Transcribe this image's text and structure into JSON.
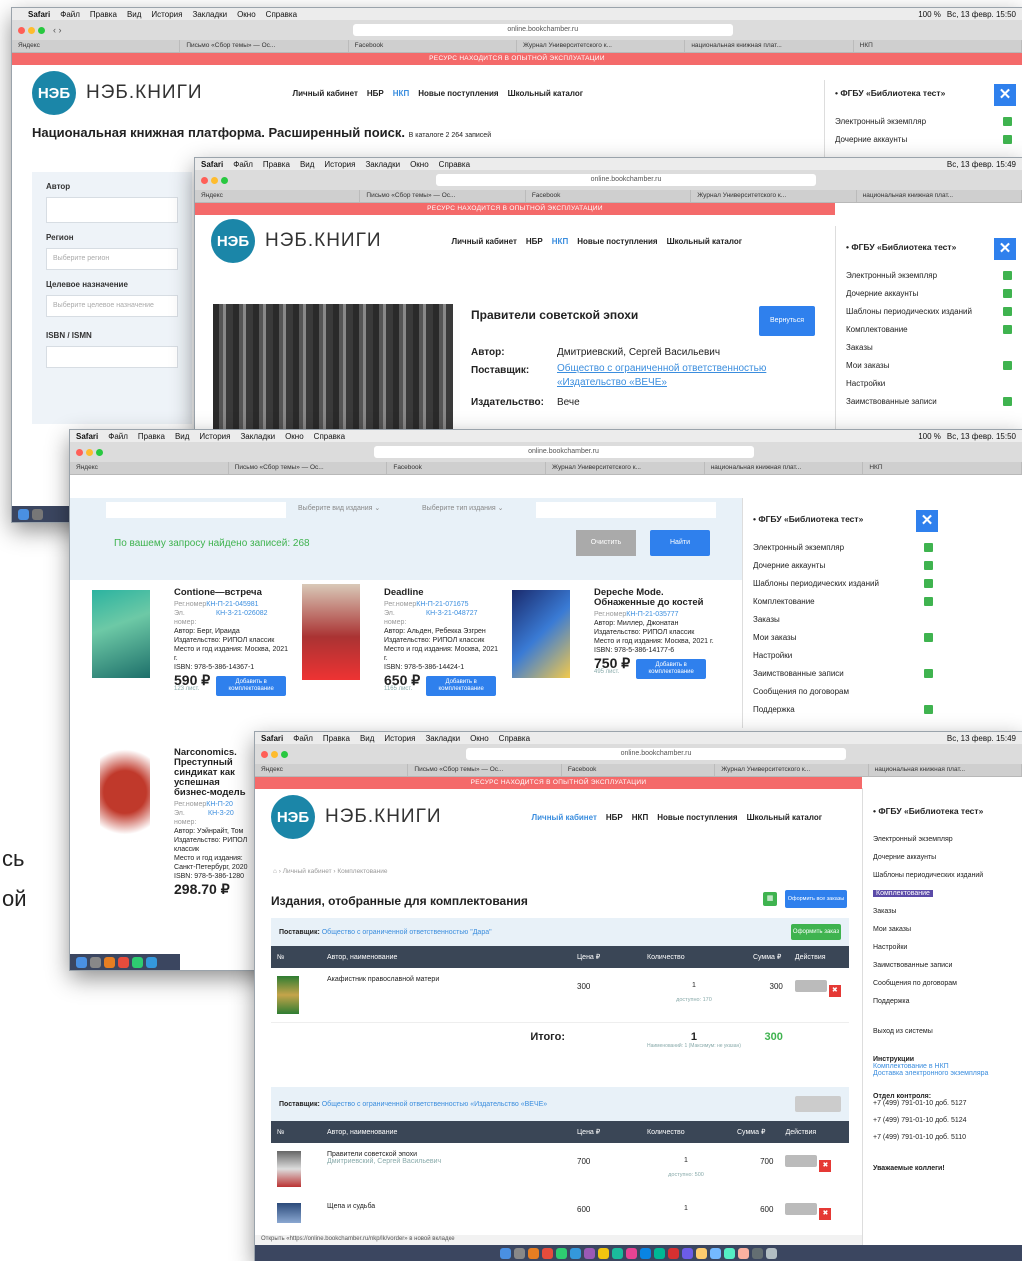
{
  "mac_menu": {
    "app": "Safari",
    "items": [
      "Файл",
      "Правка",
      "Вид",
      "История",
      "Закладки",
      "Окно",
      "Справка"
    ]
  },
  "status": {
    "battery": "100 %",
    "time1": "Вс, 13 февр. 15:50",
    "time2": "Вс, 13 февр. 15:49"
  },
  "url": "online.bookchamber.ru",
  "banner": "РЕСУРС НАХОДИТСЯ В ОПЫТНОЙ ЭКСПЛУАТАЦИИ",
  "brand": {
    "logo": "НЭБ",
    "name": "НЭБ.КНИГИ"
  },
  "nav": {
    "cabinet": "Личный кабинет",
    "nbr": "НБР",
    "nkp": "НКП",
    "new": "Новые поступления",
    "school": "Школьный каталог"
  },
  "tabs": {
    "t1": "Яндекс",
    "t2": "Письмо «Сбор темы» — Ос...",
    "t3": "Facebook",
    "t4": "Журнал Университетского к...",
    "t5": "национальная книжная плат...",
    "t6": "НКП"
  },
  "side": {
    "title": "ФГБУ «Библиотека тест»",
    "close": "✕",
    "items": [
      "Электронный экземпляр",
      "Дочерние аккаунты",
      "Шаблоны периодических изданий",
      "Комплектование",
      "Заказы",
      "Мои заказы",
      "Настройки",
      "Заимствованные записи",
      "Сообщения по договорам",
      "Поддержка"
    ],
    "logout": "Выход из системы",
    "instr_title": "Инструкции",
    "instr1": "Комплектование в НКП",
    "instr2": "Доставка электронного экземпляра",
    "control_title": "Отдел контроля:",
    "phone1": "+7 (499) 791-01-10 доб. 5127",
    "phone2": "+7 (499) 791-01-10 доб. 5124",
    "phone3": "+7 (499) 791-01-10 доб. 5110",
    "bottom": "Уважаемые коллеги!"
  },
  "w1": {
    "heading": "Национальная книжная платформа. Расширенный поиск.",
    "count": "В каталоге 2 264 записей",
    "f_author": "Автор",
    "f_region": "Регион",
    "f_region_ph": "Выберите регион",
    "f_purpose": "Целевое назначение",
    "f_purpose_ph": "Выберите целевое назначение",
    "f_isbn": "ISBN / ISMN"
  },
  "w2": {
    "title": "Правители советской эпохи",
    "back": "Вернуться",
    "author_l": "Автор:",
    "author": "Дмитриевский, Сергей Васильевич",
    "supplier_l": "Поставщик:",
    "supplier1": "Общество с ограниченной ответственностью",
    "supplier2": "«Издательство «ВЕЧЕ»",
    "publisher_l": "Издательство:",
    "publisher": "Вече"
  },
  "w3": {
    "select1": "Выберите вид издания ⌄",
    "select2": "Выберите тип издания ⌄",
    "found": "По вашему запросу найдено записей: 268",
    "clear": "Очистить",
    "find": "Найти",
    "reg": "Рег.номер",
    "el": "Эл. номер:",
    "add": "Добавить в комплектование",
    "books": [
      {
        "title": "Contione—встреча",
        "reg": "КН-П-21-045981",
        "el": "КН-З-21-026082",
        "author": "Автор: Берг, Ираида",
        "pub": "Издательство: РИПОЛ классик",
        "place": "Место и год издания: Москва, 2021 г.",
        "isbn": "ISBN: 978-5-386-14367-1",
        "price": "590 ₽",
        "sub": "123 лист."
      },
      {
        "title": "Deadline",
        "reg": "КН-П-21-071675",
        "el": "КН-З-21-048727",
        "author": "Автор: Альден, Ребекка Эзгрен",
        "pub": "Издательство: РИПОЛ классик",
        "place": "Место и год издания: Москва, 2021 г.",
        "isbn": "ISBN: 978-5-386-14424-1",
        "price": "650 ₽",
        "sub": "1165 лист."
      },
      {
        "title": "Depeche Mode. Обнаженные до костей",
        "reg": "КН-П-21-035777",
        "el": "",
        "author": "Автор: Миллер, Джонатан",
        "pub": "Издательство: РИПОЛ классик",
        "place": "Место и год издания: Москва, 2021 г.",
        "isbn": "ISBN: 978-5-386-14177-6",
        "price": "750 ₽",
        "sub": "495 лист."
      },
      {
        "title": "Narconomics. Преступный синдикат как успешная бизнес-модель",
        "reg": "КН-П-20",
        "el": "КН-З-20",
        "author": "Автор: Уэйнрайт, Том",
        "pub": "Издательство: РИПОЛ классик",
        "place": "Место и год издания: Санкт-Петербург, 2020",
        "isbn": "ISBN: 978-5-386-1280",
        "price": "298,70 ₽",
        "sub": ""
      }
    ]
  },
  "w4": {
    "crumbs": "Личный кабинет  ›  Комплектование",
    "title": "Издания, отобранные для комплектования",
    "order_all": "Оформить все заказы",
    "supplier_l": "Поставщик:",
    "supplier_a": "Общество с ограниченной ответственностью \"Дара\"",
    "supplier_b": "Общество с ограниченной ответственностью «Издательство «ВЕЧЕ»",
    "order": "Оформить заказ",
    "cols": [
      "№",
      "Автор, наименование",
      "Цена ₽",
      "Количество",
      "Сумма ₽",
      "Действия"
    ],
    "row1": {
      "name": "Акафистник православной матери",
      "price": "300",
      "qty": "1",
      "note": "доступно: 170",
      "sum": "300"
    },
    "total_l": "Итого:",
    "total_qty": "1",
    "total_sum": "300",
    "total_note": "Наименований: 1 (Максимум: не указан)",
    "row2": {
      "name": "Правители советской эпохи",
      "author": "Дмитриевский, Сергей Васильевич",
      "price": "700",
      "qty": "1",
      "note": "доступно: 500",
      "sum": "700"
    },
    "row3": {
      "name": "Щепа и судьба",
      "price": "600",
      "qty": "1",
      "sum": "600"
    },
    "statusbar": "Открыть «https://online.bookchamber.ru/nkp/lk/vorder» в новой вкладке"
  },
  "left_cut": {
    "a": "сь",
    "b": "ой"
  }
}
